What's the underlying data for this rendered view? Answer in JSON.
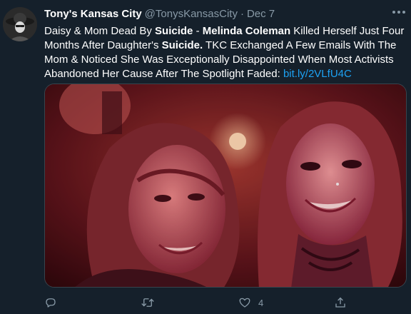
{
  "tweet": {
    "display_name": "Tony's Kansas City",
    "handle": "@TonysKansasCity",
    "separator": "·",
    "date": "Dec 7",
    "text_parts": [
      {
        "t": "Daisy & Mom Dead By "
      },
      {
        "b": "Suicide"
      },
      {
        "t": " - "
      },
      {
        "b": "Melinda Coleman"
      },
      {
        "t": " Killed Herself Just Four Months After Daughter's "
      },
      {
        "b": "Suicide."
      },
      {
        "t": " TKC Exchanged A Few Emails With The Mom & Noticed She Was Exceptionally Disappointed When Most Activists Abandoned Her Cause After The Spotlight Faded: "
      }
    ],
    "link": "bit.ly/2VLfU4C",
    "media": {
      "description_icon": "photo"
    },
    "actions": {
      "reply": {
        "icon": "reply-icon",
        "count": ""
      },
      "retweet": {
        "icon": "retweet-icon",
        "count": ""
      },
      "like": {
        "icon": "like-icon",
        "count": "4"
      },
      "share": {
        "icon": "share-icon",
        "count": ""
      }
    }
  },
  "colors": {
    "background": "#15202b",
    "secondary_text": "#8899a6",
    "link": "#1da1f2"
  }
}
